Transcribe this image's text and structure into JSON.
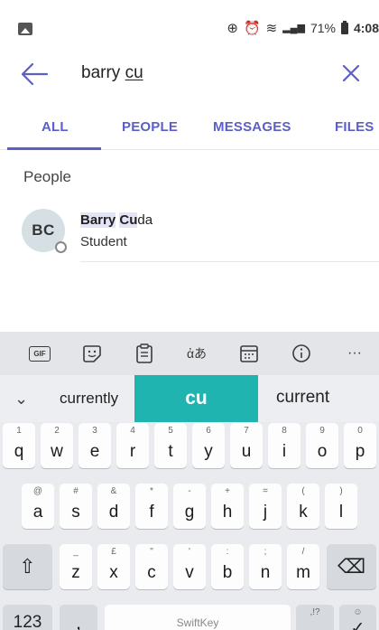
{
  "status_bar": {
    "battery_percent": "71%",
    "time": "4:08",
    "icons": [
      "gallery-icon",
      "data-saver-icon",
      "alarm-icon",
      "wifi-icon",
      "signal-icon",
      "battery-icon"
    ]
  },
  "search": {
    "query_prefix": "barry ",
    "query_typed": "cu"
  },
  "tabs": [
    {
      "label": "ALL",
      "active": true
    },
    {
      "label": "PEOPLE",
      "active": false
    },
    {
      "label": "MESSAGES",
      "active": false
    },
    {
      "label": "FILES",
      "active": false
    }
  ],
  "results": {
    "section_title": "People",
    "items": [
      {
        "initials": "BC",
        "name_first": "Barry",
        "name_match": "Cu",
        "name_rest": "da",
        "subtitle": "Student"
      }
    ]
  },
  "keyboard": {
    "toolbar_icons": [
      "gif-icon",
      "sticker-icon",
      "clipboard-icon",
      "translate-icon",
      "calendar-icon",
      "info-icon",
      "more-icon"
    ],
    "gif_label": "GIF",
    "translate_glyph": "ἀあ",
    "more_glyph": "···",
    "suggestions": {
      "left": "currently",
      "center": "cu",
      "right": "current"
    },
    "row1": [
      {
        "main": "q",
        "hint": "1"
      },
      {
        "main": "w",
        "hint": "2"
      },
      {
        "main": "e",
        "hint": "3"
      },
      {
        "main": "r",
        "hint": "4"
      },
      {
        "main": "t",
        "hint": "5"
      },
      {
        "main": "y",
        "hint": "6"
      },
      {
        "main": "u",
        "hint": "7"
      },
      {
        "main": "i",
        "hint": "8"
      },
      {
        "main": "o",
        "hint": "9"
      },
      {
        "main": "p",
        "hint": "0"
      }
    ],
    "row2": [
      {
        "main": "a",
        "hint": "@"
      },
      {
        "main": "s",
        "hint": "#"
      },
      {
        "main": "d",
        "hint": "&"
      },
      {
        "main": "f",
        "hint": "*"
      },
      {
        "main": "g",
        "hint": "-"
      },
      {
        "main": "h",
        "hint": "+"
      },
      {
        "main": "j",
        "hint": "="
      },
      {
        "main": "k",
        "hint": "("
      },
      {
        "main": "l",
        "hint": ")"
      }
    ],
    "row3": [
      {
        "main": "z",
        "hint": "_"
      },
      {
        "main": "x",
        "hint": "£"
      },
      {
        "main": "c",
        "hint": "\""
      },
      {
        "main": "v",
        "hint": "'"
      },
      {
        "main": "b",
        "hint": ":"
      },
      {
        "main": "n",
        "hint": ";"
      },
      {
        "main": "m",
        "hint": "/"
      }
    ],
    "numbers_label": "123",
    "comma": ",",
    "space_brand": "SwiftKey",
    "period_main": ".",
    "period_hint": ",!?",
    "enter_hint": "☺",
    "enter_glyph": "✓",
    "shift_glyph": "⇧",
    "backspace_glyph": "⌫"
  }
}
